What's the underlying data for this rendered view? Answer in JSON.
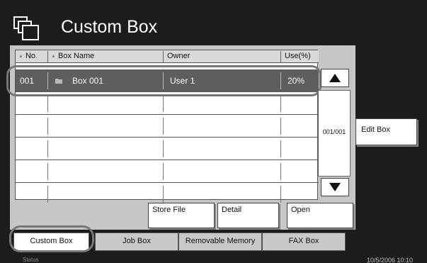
{
  "header": {
    "title": "Custom Box",
    "icon": "custom-box-icon"
  },
  "table": {
    "columns": [
      "No.",
      "Box Name",
      "Owner",
      "Use(%)"
    ],
    "rows": [
      {
        "no": "001",
        "name": "Box 001",
        "owner": "User 1",
        "use": "20%"
      }
    ],
    "empty_rows": 5
  },
  "pager": {
    "page": "001/001"
  },
  "buttons": {
    "edit_box": "Edit Box",
    "store_file": "Store File",
    "detail": "Detail",
    "open": "Open"
  },
  "tabs": [
    "Custom Box",
    "Job Box",
    "Removable Memory",
    "FAX Box"
  ],
  "footer": {
    "status": "Status",
    "datetime": "10/5/2006    10:10"
  },
  "colors": {
    "background": "#1c1c1c",
    "panel": "#c7c7c7",
    "selected_row": "#5e5e5e"
  }
}
